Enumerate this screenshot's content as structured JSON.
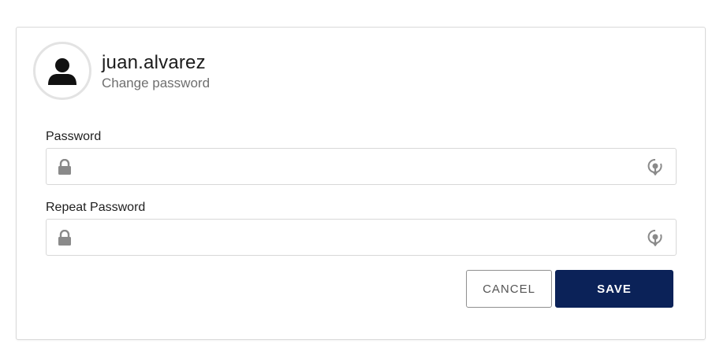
{
  "header": {
    "username": "juan.alvarez",
    "subtitle": "Change password",
    "avatar_icon": "user-silhouette-icon"
  },
  "form": {
    "password": {
      "label": "Password",
      "value": "",
      "placeholder": "",
      "leading_icon": "lock-icon",
      "trailing_icon": "show-password-icon"
    },
    "repeat_password": {
      "label": "Repeat Password",
      "value": "",
      "placeholder": "",
      "leading_icon": "lock-icon",
      "trailing_icon": "show-password-icon"
    }
  },
  "actions": {
    "cancel_label": "CANCEL",
    "save_label": "SAVE"
  },
  "colors": {
    "primary": "#0b2258",
    "border": "#d8d8d8",
    "icon_gray": "#8a8a8a"
  }
}
